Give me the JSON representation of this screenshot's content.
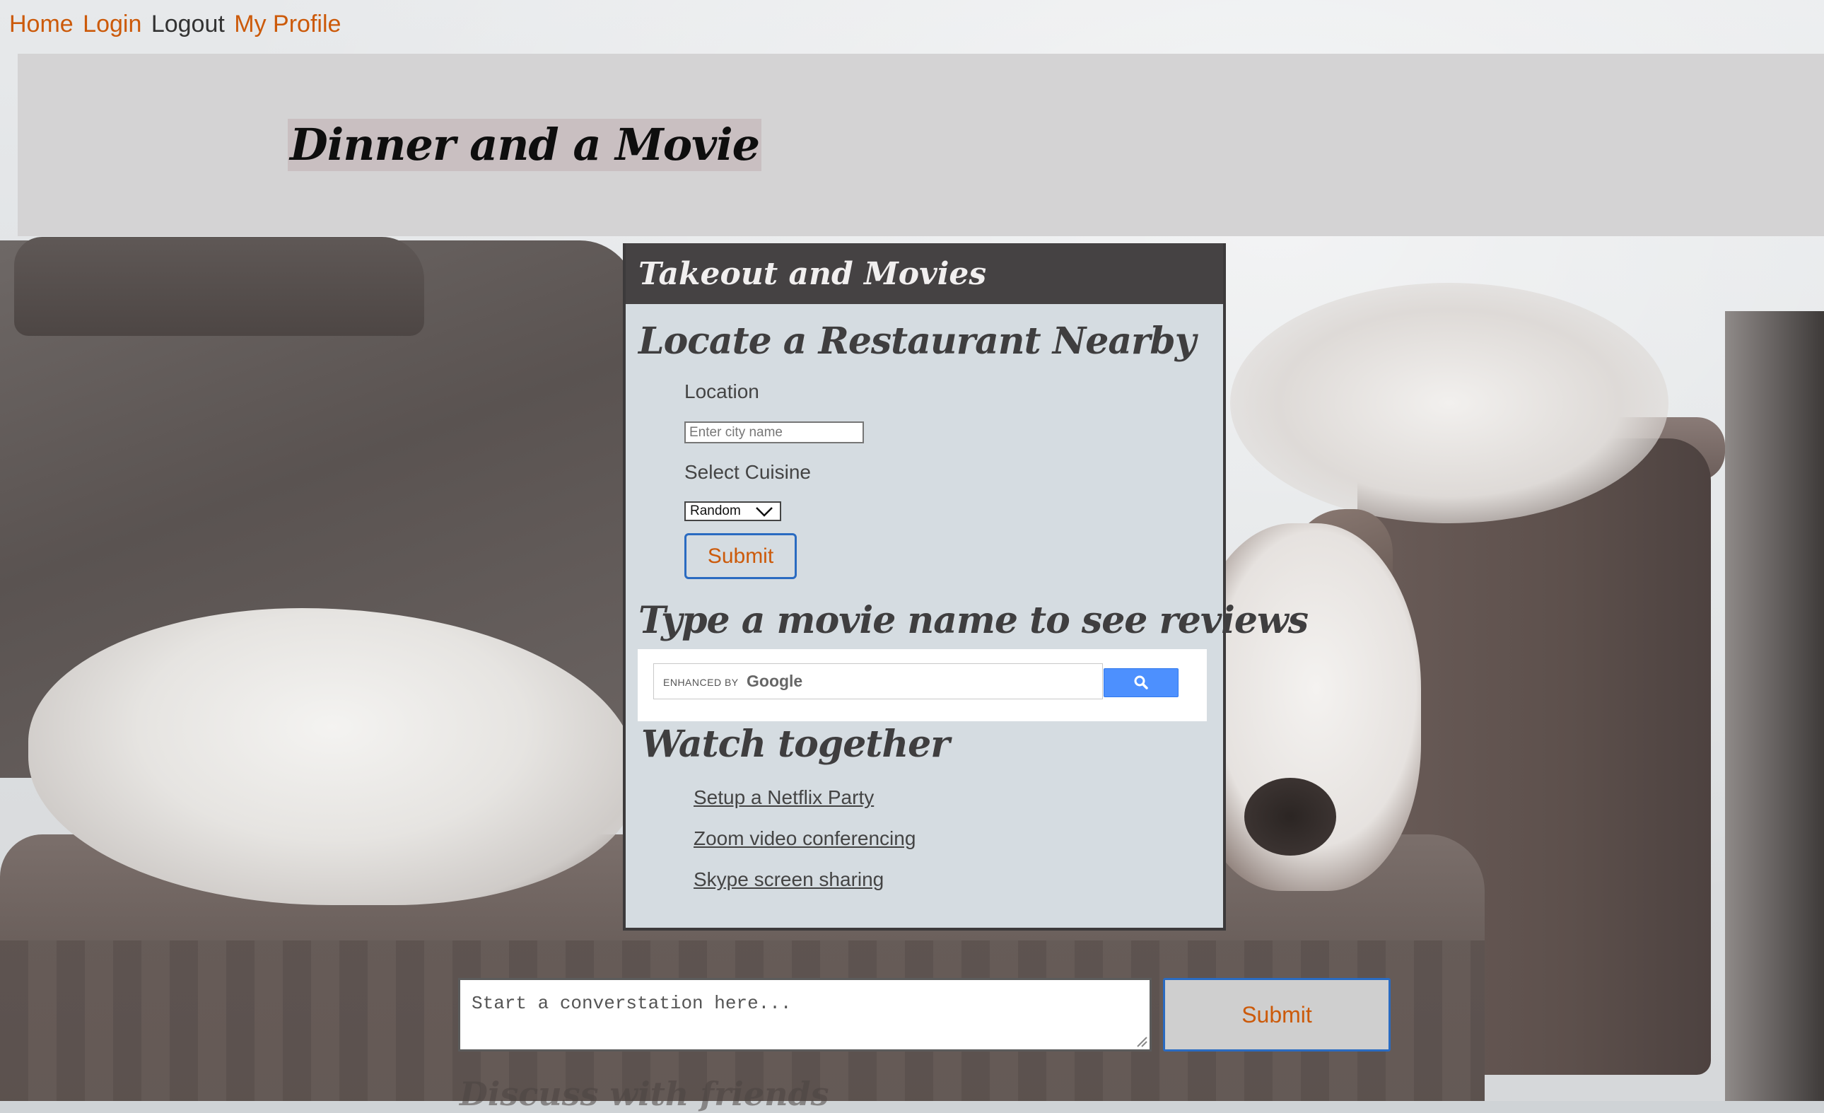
{
  "nav": {
    "home": "Home",
    "login": "Login",
    "logout": "Logout",
    "profile": "My Profile"
  },
  "header": {
    "title": "Dinner and a Movie"
  },
  "panel": {
    "title": "Takeout and Movies",
    "restaurant": {
      "heading": "Locate a Restaurant Nearby",
      "location_label": "Location",
      "location_placeholder": "Enter city name",
      "cuisine_label": "Select Cuisine",
      "cuisine_selected": "Random",
      "submit_label": "Submit"
    },
    "movies": {
      "heading": "Type a movie name to see reviews",
      "search_enhanced_by": "ENHANCED BY",
      "search_brand": "Google",
      "search_icon": "magnifier-icon"
    },
    "watch": {
      "heading": "Watch together",
      "links": [
        "Setup a Netflix Party",
        "Zoom video conferencing",
        "Skype screen sharing"
      ]
    }
  },
  "chat": {
    "placeholder": "Start a converstation here...",
    "submit_label": "Submit",
    "section_label": "Discuss with friends"
  },
  "colors": {
    "link_accent": "#cc5a0a",
    "panel_header": "#454243",
    "panel_body": "#d5dce1",
    "button_border": "#2a6bc1",
    "google_button": "#4d90fe"
  }
}
